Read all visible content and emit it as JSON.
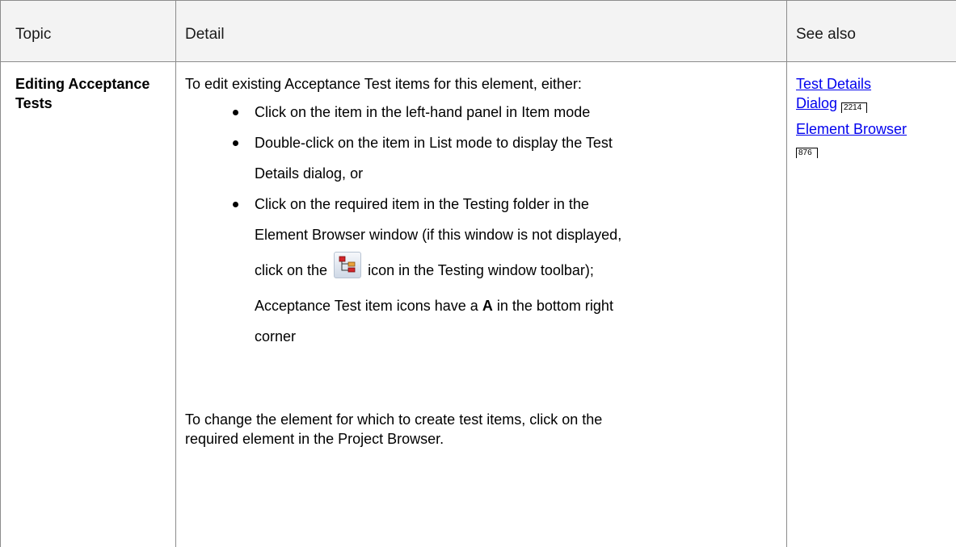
{
  "table": {
    "headers": [
      "Topic",
      "Detail",
      "See also"
    ],
    "row": {
      "topic": "Editing Acceptance Tests",
      "detail": {
        "intro": "To edit existing Acceptance Test items for this element, either:",
        "bullets": [
          "Click on the item in the left-hand panel in Item mode",
          "Double-click on the item in List mode to display the Test",
          "Details dialog, or",
          "Click on the required item in the Testing folder in the",
          "Element Browser window (if this window is not displayed,",
          "click on the",
          "icon in the Testing window toolbar);",
          "Acceptance Test item icons have a",
          "A",
          "in the bottom right",
          "corner"
        ],
        "icon": "element-browser-toolbar-icon",
        "paragraph_line1": "To change the element for which to create test items, click on the",
        "paragraph_line2": "required element in the Project Browser."
      },
      "see_also": [
        {
          "line1": "Test Details",
          "line2": "Dialog",
          "page": "2214"
        },
        {
          "line1": "Element Browser",
          "page": "876"
        }
      ]
    }
  }
}
